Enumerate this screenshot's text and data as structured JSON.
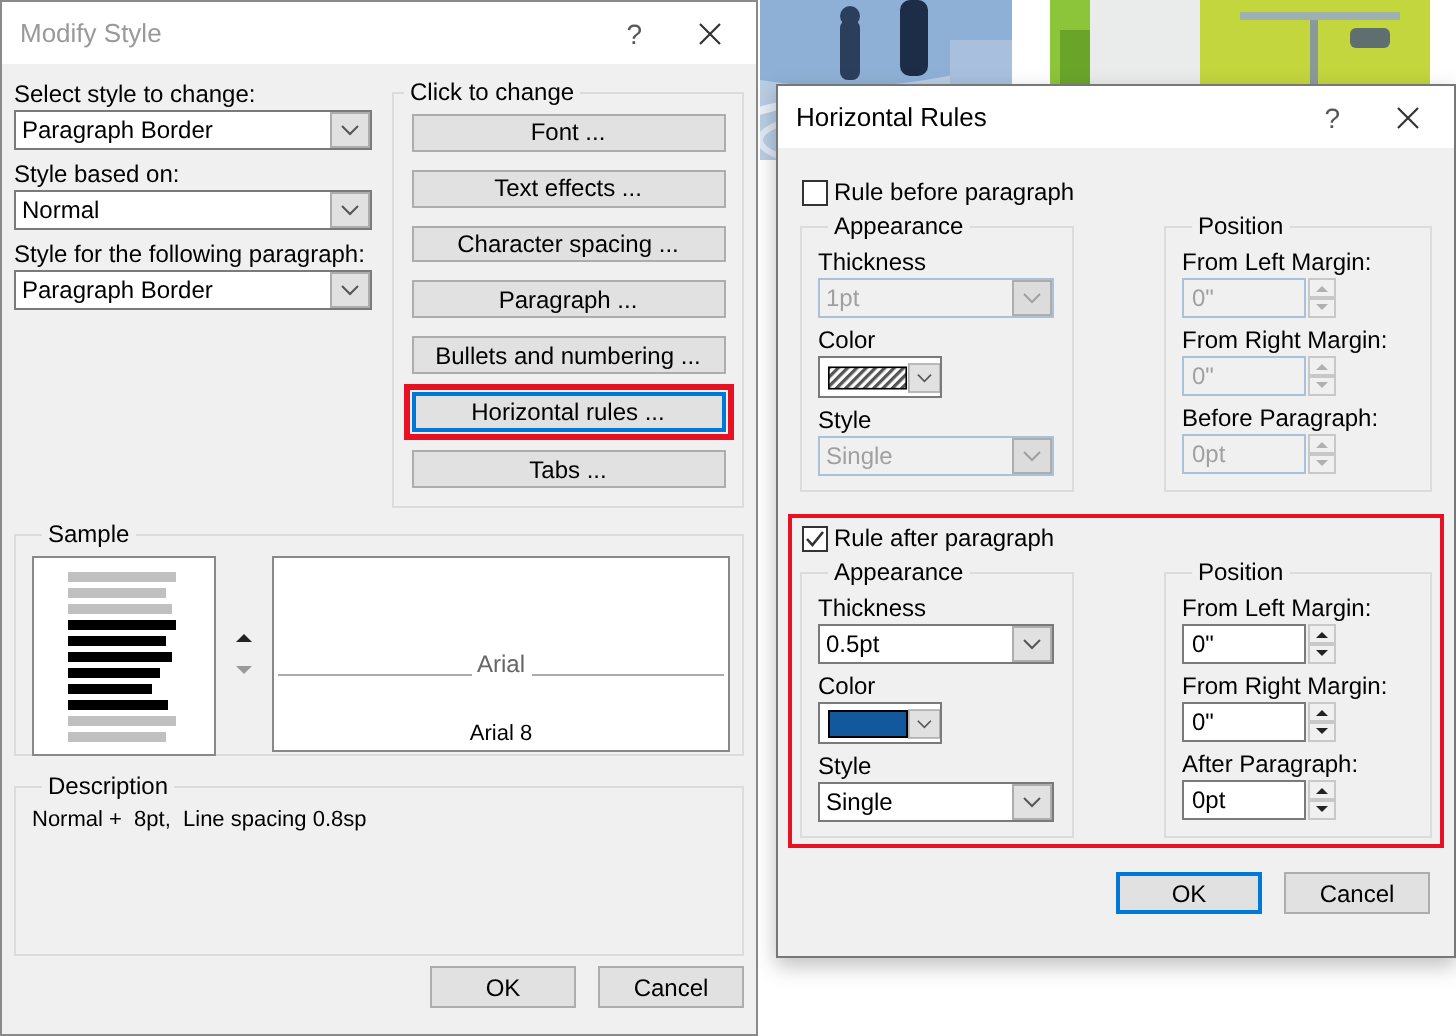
{
  "modify_style": {
    "title": "Modify Style",
    "active": false,
    "help": "?",
    "fields": [
      {
        "label": "Select style to change:",
        "value": "Paragraph Border"
      },
      {
        "label": "Style based on:",
        "value": "Normal"
      },
      {
        "label": "Style for the following paragraph:",
        "value": "Paragraph Border"
      }
    ],
    "click_to_change": {
      "title": "Click to change",
      "buttons": [
        {
          "label": "Font ...",
          "focused": false,
          "highlighted": false
        },
        {
          "label": "Text effects ...",
          "focused": false,
          "highlighted": false
        },
        {
          "label": "Character spacing ...",
          "focused": false,
          "highlighted": false
        },
        {
          "label": "Paragraph ...",
          "focused": false,
          "highlighted": false
        },
        {
          "label": "Bullets and numbering ...",
          "focused": false,
          "highlighted": false
        },
        {
          "label": "Horizontal rules ...",
          "focused": true,
          "highlighted": true
        },
        {
          "label": "Tabs ...",
          "focused": false,
          "highlighted": false
        }
      ]
    },
    "sample": {
      "title": "Sample",
      "preview_text": "Arial",
      "caption": "Arial 8"
    },
    "description": {
      "title": "Description",
      "text": "Normal +  8pt,  Line spacing 0.8sp"
    },
    "buttons": [
      {
        "label": "OK",
        "focused": false
      },
      {
        "label": "Cancel",
        "focused": false
      }
    ]
  },
  "horizontal_rules": {
    "title": "Horizontal Rules",
    "active": true,
    "help": "?",
    "sections": [
      {
        "label": "Rule before paragraph",
        "checked": false,
        "highlighted": false,
        "appearance": {
          "title": "Appearance",
          "thickness_label": "Thickness",
          "thickness": "1pt",
          "color_label": "Color",
          "style_label": "Style",
          "style": "Single"
        },
        "position": {
          "title": "Position",
          "fields": [
            {
              "label": "From Left Margin:",
              "value": "0\""
            },
            {
              "label": "From Right Margin:",
              "value": "0\""
            },
            {
              "label": "Before Paragraph:",
              "value": "0pt"
            }
          ]
        }
      },
      {
        "label": "Rule after paragraph",
        "checked": true,
        "highlighted": true,
        "appearance": {
          "title": "Appearance",
          "thickness_label": "Thickness",
          "thickness": "0.5pt",
          "color_label": "Color",
          "color": "#12589c",
          "style_label": "Style",
          "style": "Single"
        },
        "position": {
          "title": "Position",
          "fields": [
            {
              "label": "From Left Margin:",
              "value": "0\""
            },
            {
              "label": "From Right Margin:",
              "value": "0\""
            },
            {
              "label": "After Paragraph:",
              "value": "0pt"
            }
          ]
        }
      }
    ],
    "buttons": [
      {
        "label": "OK",
        "focused": true
      },
      {
        "label": "Cancel",
        "focused": false
      }
    ]
  }
}
